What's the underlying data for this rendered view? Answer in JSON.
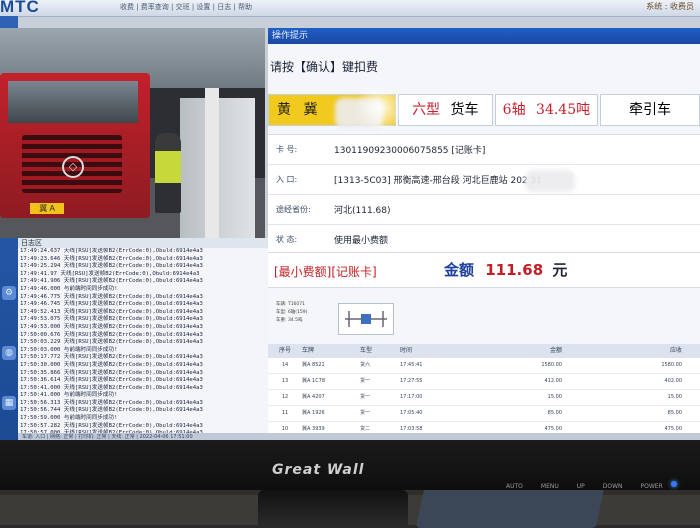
{
  "app": {
    "logo": "MTC",
    "menu_text": "收费 | 费率查询 | 交班 | 设置 | 日志 | 帮助",
    "top_right": "系统 : 收费员"
  },
  "camera": {
    "plate_text": "冀 A"
  },
  "log": {
    "title": "日志区",
    "lines": [
      "17:49:24.637 天线[RSU]发送帧B2(ErrCode:0),Obuld:6914e4a3",
      "17:49:23.646 天线[RSU]发送帧B2(ErrCode:0),Obuld:6914e4a3",
      "17:49:25.294 天线[RSU]发送帧B2(ErrCode:0),Obuld:6914e4a3",
      "17:49:41.97 天线[RSU]发送帧B2(ErrCode:0),Obuld:6914e4a3",
      "17:49:41.906 天线[RSU]发送帧B2(ErrCode:0),Obuld:6914e4a3",
      "17:49:46.000 与前端时间同步成功!",
      "17:49:46.775 天线[RSU]发送帧B2(ErrCode:0),Obuld:6914e4a3",
      "17:49:46.745 天线[RSU]发送帧B2(ErrCode:0),Obuld:6914e4a3",
      "17:49:52.413 天线[RSU]发送帧B2(ErrCode:0),Obuld:6914e4a3",
      "17:49:53.075 天线[RSU]发送帧B2(ErrCode:0),Obuld:6914e4a3",
      "17:49:53.000 天线[RSU]发送帧B2(ErrCode:0),Obuld:6914e4a3",
      "17:50:00.676 天线[RSU]发送帧B2(ErrCode:0),Obuld:6914e4a3",
      "17:50:03.229 天线[RSU]发送帧B2(ErrCode:0),Obuld:6914e4a3",
      "17:50:03.000 与前端时间同步成功!",
      "17:50:17.772 天线[RSU]发送帧B2(ErrCode:0),Obuld:6914e4a3",
      "17:50:30.000 天线[RSU]发送帧B2(ErrCode:0),Obuld:6914e4a3",
      "17:50:35.866 天线[RSU]发送帧B2(ErrCode:0),Obuld:6914e4a3",
      "17:50:36.614 天线[RSU]发送帧B2(ErrCode:0),Obuld:6914e4a3",
      "17:50:41.000 天线[RSU]发送帧B2(ErrCode:0),Obuld:6914e4a3",
      "17:50:41.000 与前端时间同步成功!",
      "17:50:56.313 天线[RSU]发送帧B2(ErrCode:0),Obuld:6914e4a3",
      "17:50:56.744 天线[RSU]发送帧B2(ErrCode:0),Obuld:6914e4a3",
      "17:50:59.000 与前端时间同步成功!",
      "17:50:57.282 天线[RSU]发送帧B2(ErrCode:0),Obuld:6914e4a3",
      "17:50:57.000 天线[RSU]发送帧B2(ErrCode:0),Obuld:6914e4a3",
      "17:50:58.000 天线[RSU]发送帧B2(ErrCode:0),Obuld:6914e4a3",
      "17:51:00.000 天线[RSU]发送帧B2(ErrCode:0),Obuld:6914e4a3"
    ]
  },
  "status_bar": "车道: 入口  |  网络: 正常  |  打印机: 正常  |  天线: 正常  |  2022-04-06 17:51:00",
  "panel": {
    "header": "操作提示",
    "prompt": "请按【确认】键扣费",
    "vehicle": {
      "plate_color": "黄",
      "plate_prefix": "冀",
      "vehicle_type": "六型",
      "vehicle_kind": "货车",
      "axles": "6轴",
      "weight": "34.45吨",
      "class": "牵引车"
    },
    "info": [
      {
        "label": "卡    号:",
        "value": "13011909230006075855 [记账卡]"
      },
      {
        "label": "入    口:",
        "value": "[1313-5C03] 邢衡高速-邢台段 河北巨鹿站 202          31"
      },
      {
        "label": "途经省份:",
        "value": "河北(111.68)"
      },
      {
        "label": "状    态:",
        "value": "使用最小费额"
      }
    ],
    "fee_tag": "[最小费额][记账卡]",
    "fee_label": "金额",
    "fee_amount": "111.68",
    "fee_unit": "元",
    "axle_meta": [
      "车辆: T16071",
      "车型: 6轴(159)",
      "车重: 34.5吨"
    ],
    "table": {
      "headers": [
        "序号",
        "车牌",
        "车型",
        "时间",
        "金额",
        "应收"
      ],
      "rows": [
        [
          "14",
          "冀A 8521",
          "货六",
          "17:45:41",
          "1580.00",
          "1580.00"
        ],
        [
          "13",
          "冀A 1C78",
          "货一",
          "17:27:55",
          "412.00",
          "402.00"
        ],
        [
          "12",
          "冀A 4207",
          "货一",
          "17:17:00",
          "15.00",
          "15.00"
        ],
        [
          "11",
          "冀A 1926",
          "货一",
          "17:05:40",
          "85.00",
          "85.00"
        ],
        [
          "10",
          "冀A 3939",
          "货二",
          "17:03:58",
          "475.00",
          "475.00"
        ]
      ]
    }
  },
  "monitor": {
    "brand": "Great Wall",
    "buttons": [
      "AUTO",
      "MENU",
      "UP",
      "DOWN",
      "POWER"
    ]
  }
}
